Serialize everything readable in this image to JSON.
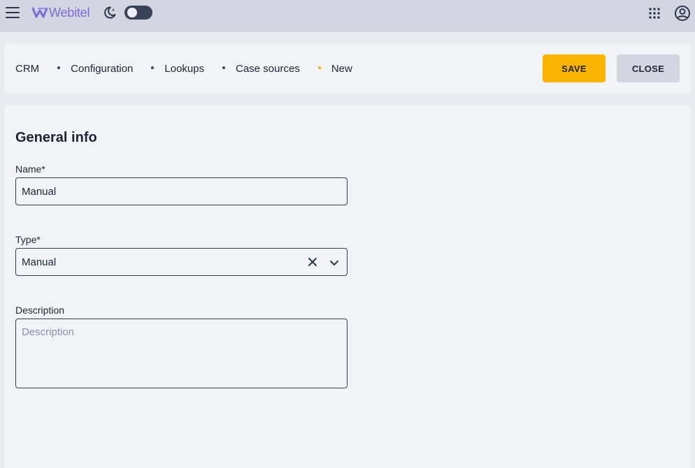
{
  "app": {
    "brand": "Webitel",
    "brand_color": "#7c6bd6",
    "icons": {
      "menu": "hamburger-icon",
      "theme": "moon-icon",
      "apps": "grid-icon",
      "account": "account-icon"
    }
  },
  "breadcrumb": {
    "items": [
      "CRM",
      "Configuration",
      "Lookups",
      "Case sources",
      "New"
    ]
  },
  "actions": {
    "save_label": "SAVE",
    "close_label": "CLOSE",
    "save_color": "#fab400"
  },
  "form": {
    "section_title": "General info",
    "name": {
      "label": "Name*",
      "value": "Manual"
    },
    "type": {
      "label": "Type*",
      "value": "Manual"
    },
    "description": {
      "label": "Description",
      "placeholder": "Description",
      "value": ""
    }
  }
}
